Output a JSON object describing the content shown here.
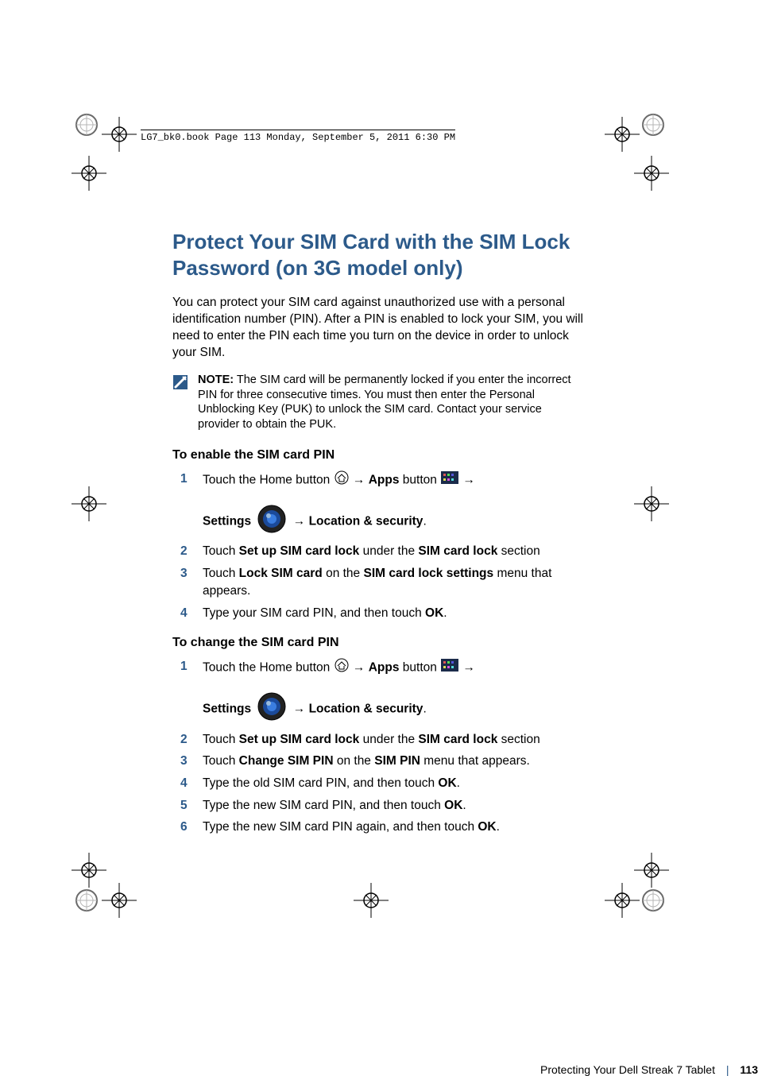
{
  "stamp": "LG7_bk0.book  Page 113  Monday, September 5, 2011  6:30 PM",
  "title": "Protect Your SIM Card with the SIM Lock Password (on 3G model only)",
  "intro": "You can protect your SIM card against unauthorized use with a personal identification number (PIN). After a PIN is enabled to lock your SIM, you will need to enter the PIN each time you turn on the device in order to unlock your SIM.",
  "note": {
    "label": "NOTE:",
    "text": " The SIM card will be permanently locked if you enter the incorrect PIN for three consecutive times. You must then enter the Personal Unblocking Key (PUK) to unlock the SIM card. Contact your service provider to obtain the PUK."
  },
  "enable": {
    "heading": "To enable the SIM card PIN",
    "s1_a": "Touch the Home button ",
    "s1_b": "Apps",
    "s1_c": " button ",
    "s1_settings": "Settings",
    "s1_locsec": "Location & security",
    "s2_a": "Touch ",
    "s2_b": "Set up SIM card lock",
    "s2_c": " under the ",
    "s2_d": "SIM card lock",
    "s2_e": " section",
    "s3_a": "Touch ",
    "s3_b": "Lock SIM card",
    "s3_c": " on the ",
    "s3_d": "SIM card lock settings",
    "s3_e": " menu that appears.",
    "s4_a": "Type your SIM card PIN, and then touch ",
    "s4_b": "OK",
    "s4_c": "."
  },
  "change": {
    "heading": "To change the SIM card PIN",
    "s1_a": "Touch the Home button ",
    "s1_b": "Apps",
    "s1_c": " button ",
    "s1_settings": "Settings",
    "s1_locsec": "Location & security",
    "s2_a": "Touch ",
    "s2_b": "Set up SIM card lock",
    "s2_c": " under the ",
    "s2_d": "SIM card lock",
    "s2_e": " section",
    "s3_a": "Touch ",
    "s3_b": "Change SIM PIN",
    "s3_c": " on the ",
    "s3_d": "SIM PIN",
    "s3_e": " menu that appears.",
    "s4_a": "Type the old SIM card PIN, and then touch ",
    "s4_b": "OK",
    "s4_c": ".",
    "s5_a": "Type the new SIM card PIN, and then touch ",
    "s5_b": "OK",
    "s5_c": ".",
    "s6_a": "Type the new SIM card PIN again, and then touch ",
    "s6_b": "OK",
    "s6_c": "."
  },
  "footer": {
    "chapter": "Protecting Your Dell Streak 7 Tablet",
    "page": "113"
  },
  "arrow": "→"
}
